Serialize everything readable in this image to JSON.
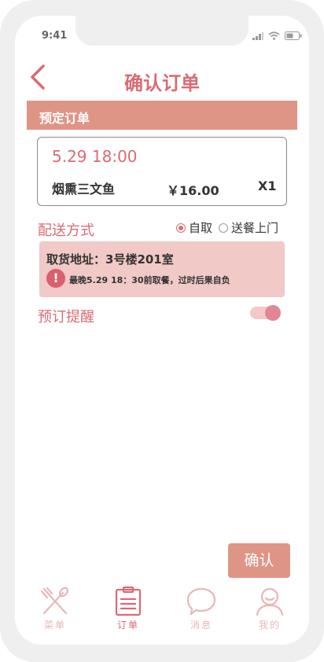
{
  "status_bar": {
    "time": "9:41"
  },
  "header": {
    "title": "确认订单",
    "back_icon": "chevron-left-icon"
  },
  "section": {
    "title": "预定订单"
  },
  "order": {
    "time": "5.29 18:00",
    "item_name": "烟熏三文鱼",
    "price": "￥16.00",
    "quantity": "X1"
  },
  "delivery": {
    "label": "配送方式",
    "options": [
      {
        "label": "自取",
        "selected": true
      },
      {
        "label": "送餐上门",
        "selected": false
      }
    ]
  },
  "pickup": {
    "address": "取货地址：3号楼201室",
    "warning_icon": "!",
    "note": "最晚5.29 18：30前取餐，过时后果自负"
  },
  "reminder": {
    "label": "预订提醒",
    "enabled": true
  },
  "confirm": {
    "label": "确认"
  },
  "tabs": [
    {
      "label": "菜单",
      "icon": "fork-knife-icon",
      "active": false
    },
    {
      "label": "订单",
      "icon": "clipboard-icon",
      "active": true
    },
    {
      "label": "消息",
      "icon": "chat-bubble-icon",
      "active": false
    },
    {
      "label": "我的",
      "icon": "user-icon",
      "active": false
    }
  ],
  "colors": {
    "accent": "#d96b74",
    "bar": "#df9586",
    "light": "#f1c9c6",
    "tab_inactive": "#e8b7b7"
  }
}
